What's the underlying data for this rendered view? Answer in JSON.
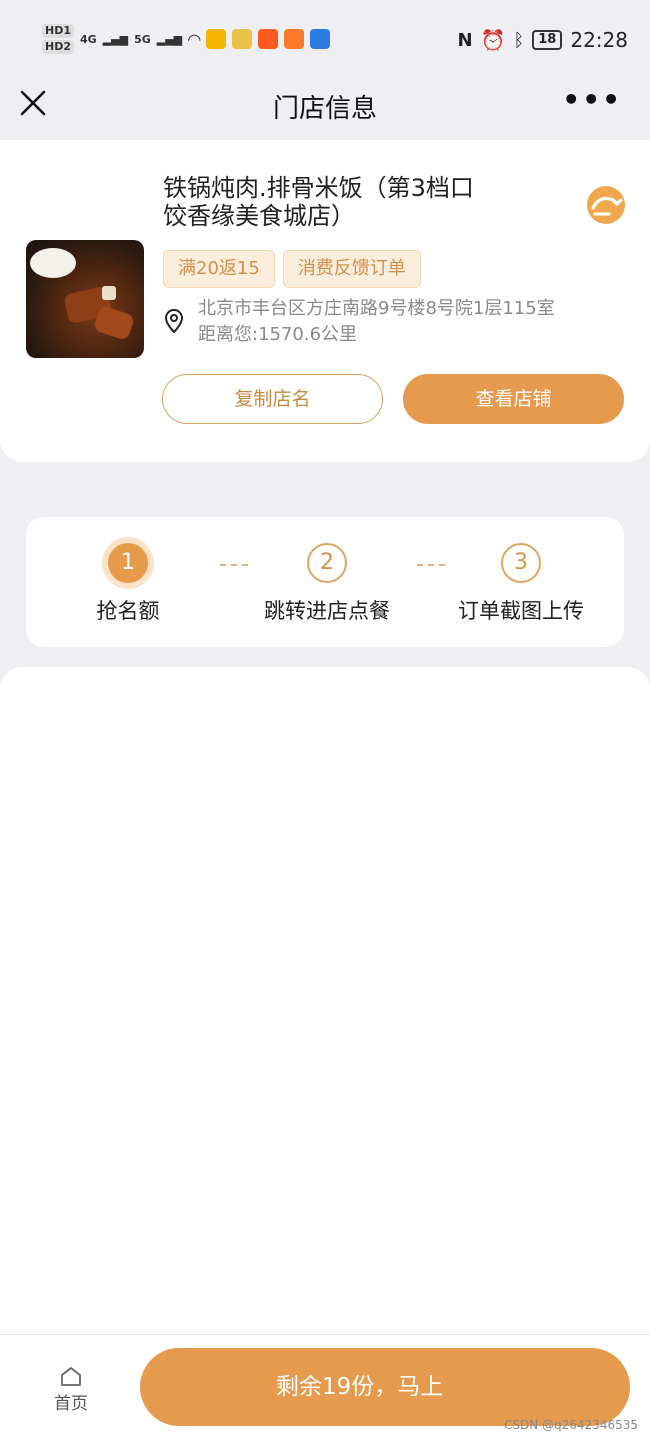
{
  "status_bar": {
    "chips": [
      "HD1",
      "HD2"
    ],
    "signals": [
      "4G",
      "5G"
    ],
    "battery": "18",
    "time": "22:28"
  },
  "nav": {
    "title": "门店信息"
  },
  "store": {
    "name": "铁锅炖肉.排骨米饭（第3档口饺香缘美食城店）",
    "tags": [
      "满20返15",
      "消费反馈订单"
    ],
    "address": "北京市丰台区方庄南路9号楼8号院1层115室",
    "distance": "距离您:1570.6公里",
    "copy_button": "复制店名",
    "view_button": "查看店铺"
  },
  "steps": [
    {
      "num": "1",
      "label": "抢名额",
      "state": "active"
    },
    {
      "num": "2",
      "label": "跳转进店点餐",
      "state": "inactive"
    },
    {
      "num": "3",
      "label": "订单截图上传",
      "state": "inactive"
    }
  ],
  "bottom": {
    "home_label": "首页",
    "cta_label": "剩余19份，马上"
  },
  "watermark": "CSDN @q2642346535",
  "colors": {
    "accent": "#e59a4e",
    "tag_bg": "#fbeedd",
    "page_bg": "#efeff3"
  }
}
